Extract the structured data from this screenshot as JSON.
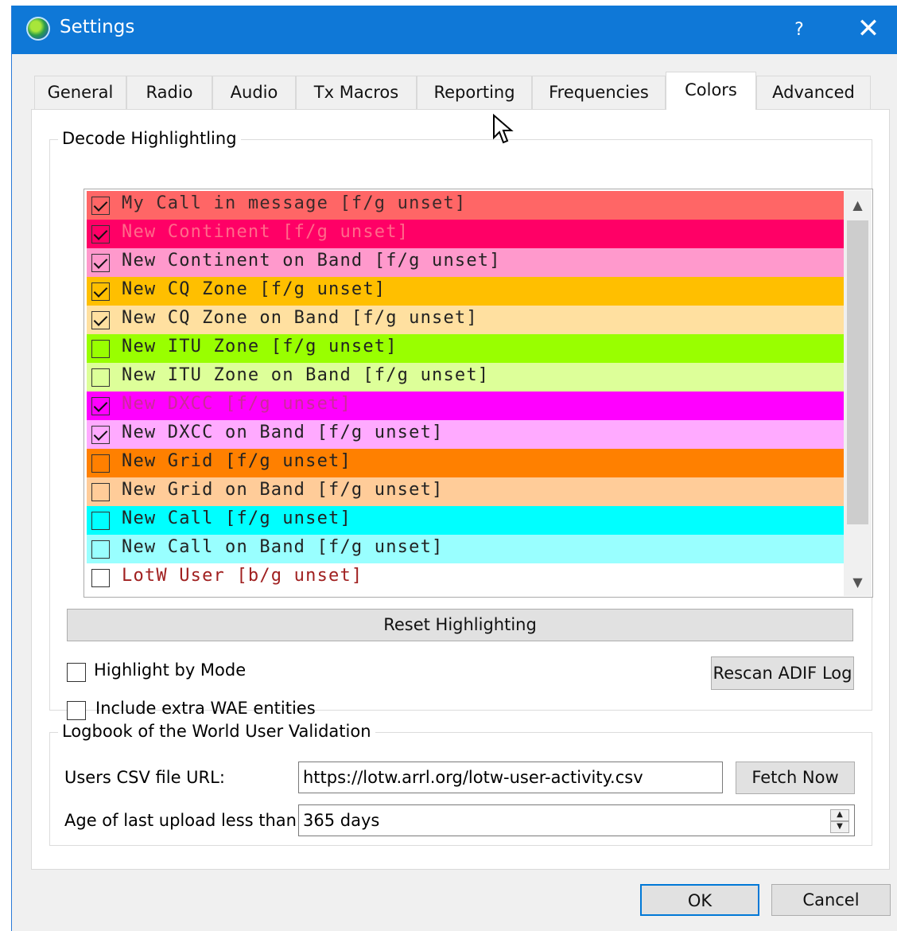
{
  "window": {
    "title": "Settings",
    "help_label": "?",
    "close_label": "✕"
  },
  "tabs": [
    {
      "label": "General"
    },
    {
      "label": "Radio"
    },
    {
      "label": "Audio"
    },
    {
      "label": "Tx Macros"
    },
    {
      "label": "Reporting"
    },
    {
      "label": "Frequencies"
    },
    {
      "label": "Colors",
      "active": true
    },
    {
      "label": "Advanced"
    }
  ],
  "decode": {
    "title": "Decode Highlightling",
    "items": [
      {
        "label": "My Call in message [f/g unset]",
        "checked": true,
        "bg": "#ff6666",
        "fg": "#3a2a2a"
      },
      {
        "label": "New Continent [f/g unset]",
        "checked": true,
        "bg": "#ff0066",
        "fg": "#ff6a8a"
      },
      {
        "label": "New Continent on Band [f/g unset]",
        "checked": true,
        "bg": "#ff99cc",
        "fg": "#222222"
      },
      {
        "label": "New CQ Zone [f/g unset]",
        "checked": true,
        "bg": "#ffbf00",
        "fg": "#222222"
      },
      {
        "label": "New CQ Zone on Band [f/g unset]",
        "checked": true,
        "bg": "#ffe0a0",
        "fg": "#222222"
      },
      {
        "label": "New ITU Zone [f/g unset]",
        "checked": false,
        "bg": "#99ff00",
        "fg": "#222222"
      },
      {
        "label": "New ITU Zone on Band [f/g unset]",
        "checked": false,
        "bg": "#ddff99",
        "fg": "#222222"
      },
      {
        "label": "New DXCC [f/g unset]",
        "checked": true,
        "bg": "#ff00ff",
        "fg": "#cc2a99"
      },
      {
        "label": "New DXCC on Band [f/g unset]",
        "checked": true,
        "bg": "#ffaaff",
        "fg": "#222222"
      },
      {
        "label": "New Grid [f/g unset]",
        "checked": false,
        "bg": "#ff8000",
        "fg": "#222222"
      },
      {
        "label": "New Grid on Band [f/g unset]",
        "checked": false,
        "bg": "#ffcc99",
        "fg": "#222222"
      },
      {
        "label": "New Call [f/g unset]",
        "checked": false,
        "bg": "#00ffff",
        "fg": "#222222"
      },
      {
        "label": "New Call on Band [f/g unset]",
        "checked": false,
        "bg": "#99ffff",
        "fg": "#222222"
      },
      {
        "label": "LotW User [b/g unset]",
        "checked": false,
        "bg": "#ffffff",
        "fg": "#a02020"
      }
    ],
    "reset_label": "Reset Highlighting",
    "highlight_by_mode_label": "Highlight by Mode",
    "include_wae_label": "Include extra WAE entities",
    "rescan_label": "Rescan ADIF Log"
  },
  "lotw": {
    "title": "Logbook of the World User Validation",
    "csv_label": "Users CSV file URL:",
    "csv_value": "https://lotw.arrl.org/lotw-user-activity.csv",
    "fetch_label": "Fetch Now",
    "age_label": "Age of last upload less than:",
    "age_value": "365 days"
  },
  "buttons": {
    "ok_label": "OK",
    "cancel_label": "Cancel"
  }
}
